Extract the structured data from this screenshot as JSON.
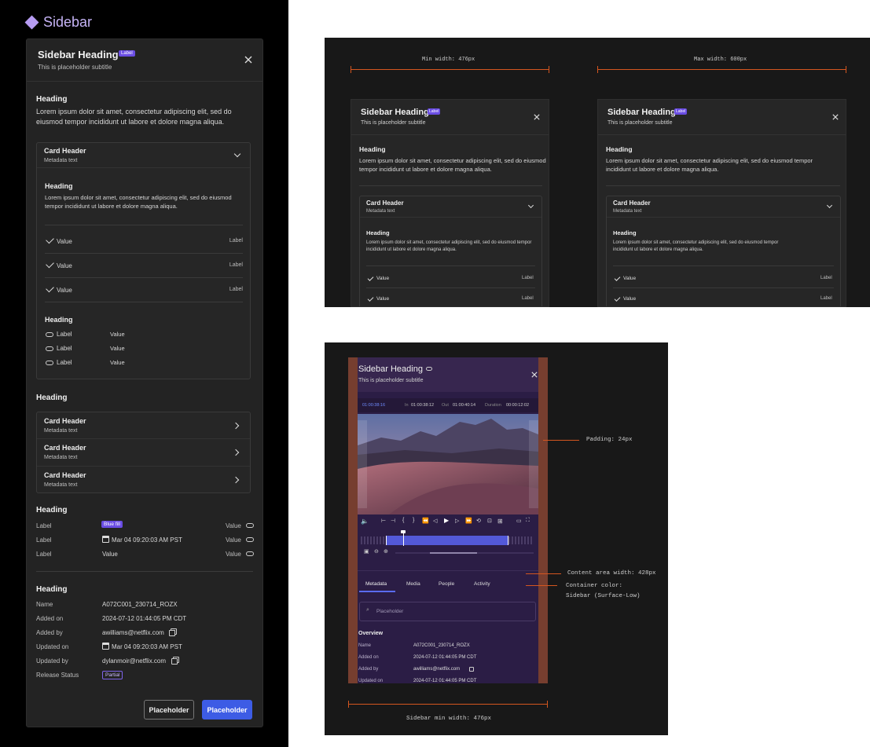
{
  "left": {
    "brand": "Sidebar",
    "sidebar": {
      "title": "Sidebar Heading",
      "badge": "Label",
      "subtitle": "This is placeholder subtitle",
      "section1": {
        "heading": "Heading",
        "text": "Lorem ipsum dolor sit amet, consectetur adipiscing elit, sed do eiusmod tempor incididunt ut labore et dolore magna aliqua."
      },
      "accordion": {
        "header": "Card Header",
        "meta": "Metadata text",
        "heading": "Heading",
        "text": "Lorem ipsum dolor sit amet, consectetur adipiscing elit, sed do eiusmod tempor incididunt ut labore et dolore magna aliqua.",
        "checks": [
          {
            "value": "Value",
            "label": "Label"
          },
          {
            "value": "Value",
            "label": "Label"
          },
          {
            "value": "Value",
            "label": "Label"
          }
        ],
        "heading2": "Heading",
        "pairs": [
          {
            "label": "Label",
            "value": "Value"
          },
          {
            "label": "Label",
            "value": "Value"
          },
          {
            "label": "Label",
            "value": "Value"
          }
        ]
      },
      "section2": {
        "heading": "Heading",
        "cards": [
          {
            "header": "Card Header",
            "meta": "Metadata text"
          },
          {
            "header": "Card Header",
            "meta": "Metadata text"
          },
          {
            "header": "Card Header",
            "meta": "Metadata text"
          }
        ]
      },
      "section3": {
        "heading": "Heading",
        "rows": [
          {
            "label": "Label",
            "mid": "Blue fill",
            "value": "Value"
          },
          {
            "label": "Label",
            "mid": "Mar 04 09:20:03 AM PST",
            "value": "Value"
          },
          {
            "label": "Label",
            "mid": "Value",
            "value": "Value"
          }
        ]
      },
      "section4": {
        "heading": "Heading",
        "rows": [
          {
            "label": "Name",
            "value": "A072C001_230714_ROZX"
          },
          {
            "label": "Added on",
            "value": "2024-07-12 01:44:05 PM CDT"
          },
          {
            "label": "Added by",
            "value": "awilliams@netflix.com"
          },
          {
            "label": "Updated on",
            "value": "Mar 04 09:20:03 AM PST"
          },
          {
            "label": "Updated by",
            "value": "dylanmoir@netflix.com"
          },
          {
            "label": "Release Status",
            "value": "Partial"
          }
        ]
      },
      "footer": {
        "secondary": "Placeholder",
        "primary": "Placeholder"
      }
    }
  },
  "top_right": {
    "min_label": "Min width: 476px",
    "max_label": "Max width: 600px",
    "panel": {
      "title": "Sidebar Heading",
      "badge": "Label",
      "subtitle": "This is placeholder subtitle",
      "heading": "Heading",
      "text": "Lorem ipsum dolor sit amet, consectetur adipiscing elit, sed do eiusmod tempor incididunt ut labore et dolore magna aliqua.",
      "card_header": "Card Header",
      "card_meta": "Metadata text",
      "card_heading": "Heading",
      "card_text": "Lorem ipsum dolor sit amet, consectetur adipiscing elit, sed do eiusmod tempor incididunt ut labore et dolore magna aliqua.",
      "rows": [
        {
          "value": "Value",
          "label": "Label"
        },
        {
          "value": "Value",
          "label": "Label"
        }
      ]
    }
  },
  "bottom_right": {
    "title": "Sidebar Heading",
    "subtitle": "This is placeholder subtitle",
    "timecode": {
      "current": "01:00:38:16",
      "in_label": "In",
      "in": "01:00:38:12",
      "out_label": "Out",
      "out": "01:00:40:14",
      "dur_label": "Duration",
      "dur": "00:00:12:02"
    },
    "tabs": [
      "Metadata",
      "Media",
      "People",
      "Activity"
    ],
    "search_placeholder": "Placeholder",
    "overview": "Overview",
    "rows": [
      {
        "label": "Name",
        "value": "A072C001_230714_ROZX"
      },
      {
        "label": "Added on",
        "value": "2024-07-12 01:44:05 PM CDT"
      },
      {
        "label": "Added by",
        "value": "awilliams@netflix.com"
      },
      {
        "label": "Updated on",
        "value": "2024-07-12 01:44:05 PM CDT"
      }
    ],
    "notes": {
      "padding": "Padding: 24px",
      "content": "Content area width: 428px",
      "container1": "Container color:",
      "container2": "Sidebar (Surface-Low)",
      "min": "Sidebar min width: 476px"
    }
  },
  "colors": {
    "accent": "#6a4de3",
    "primary_button": "#3d5ce5",
    "annotation": "#d4561f",
    "purple_surface": "#2b1d45"
  }
}
